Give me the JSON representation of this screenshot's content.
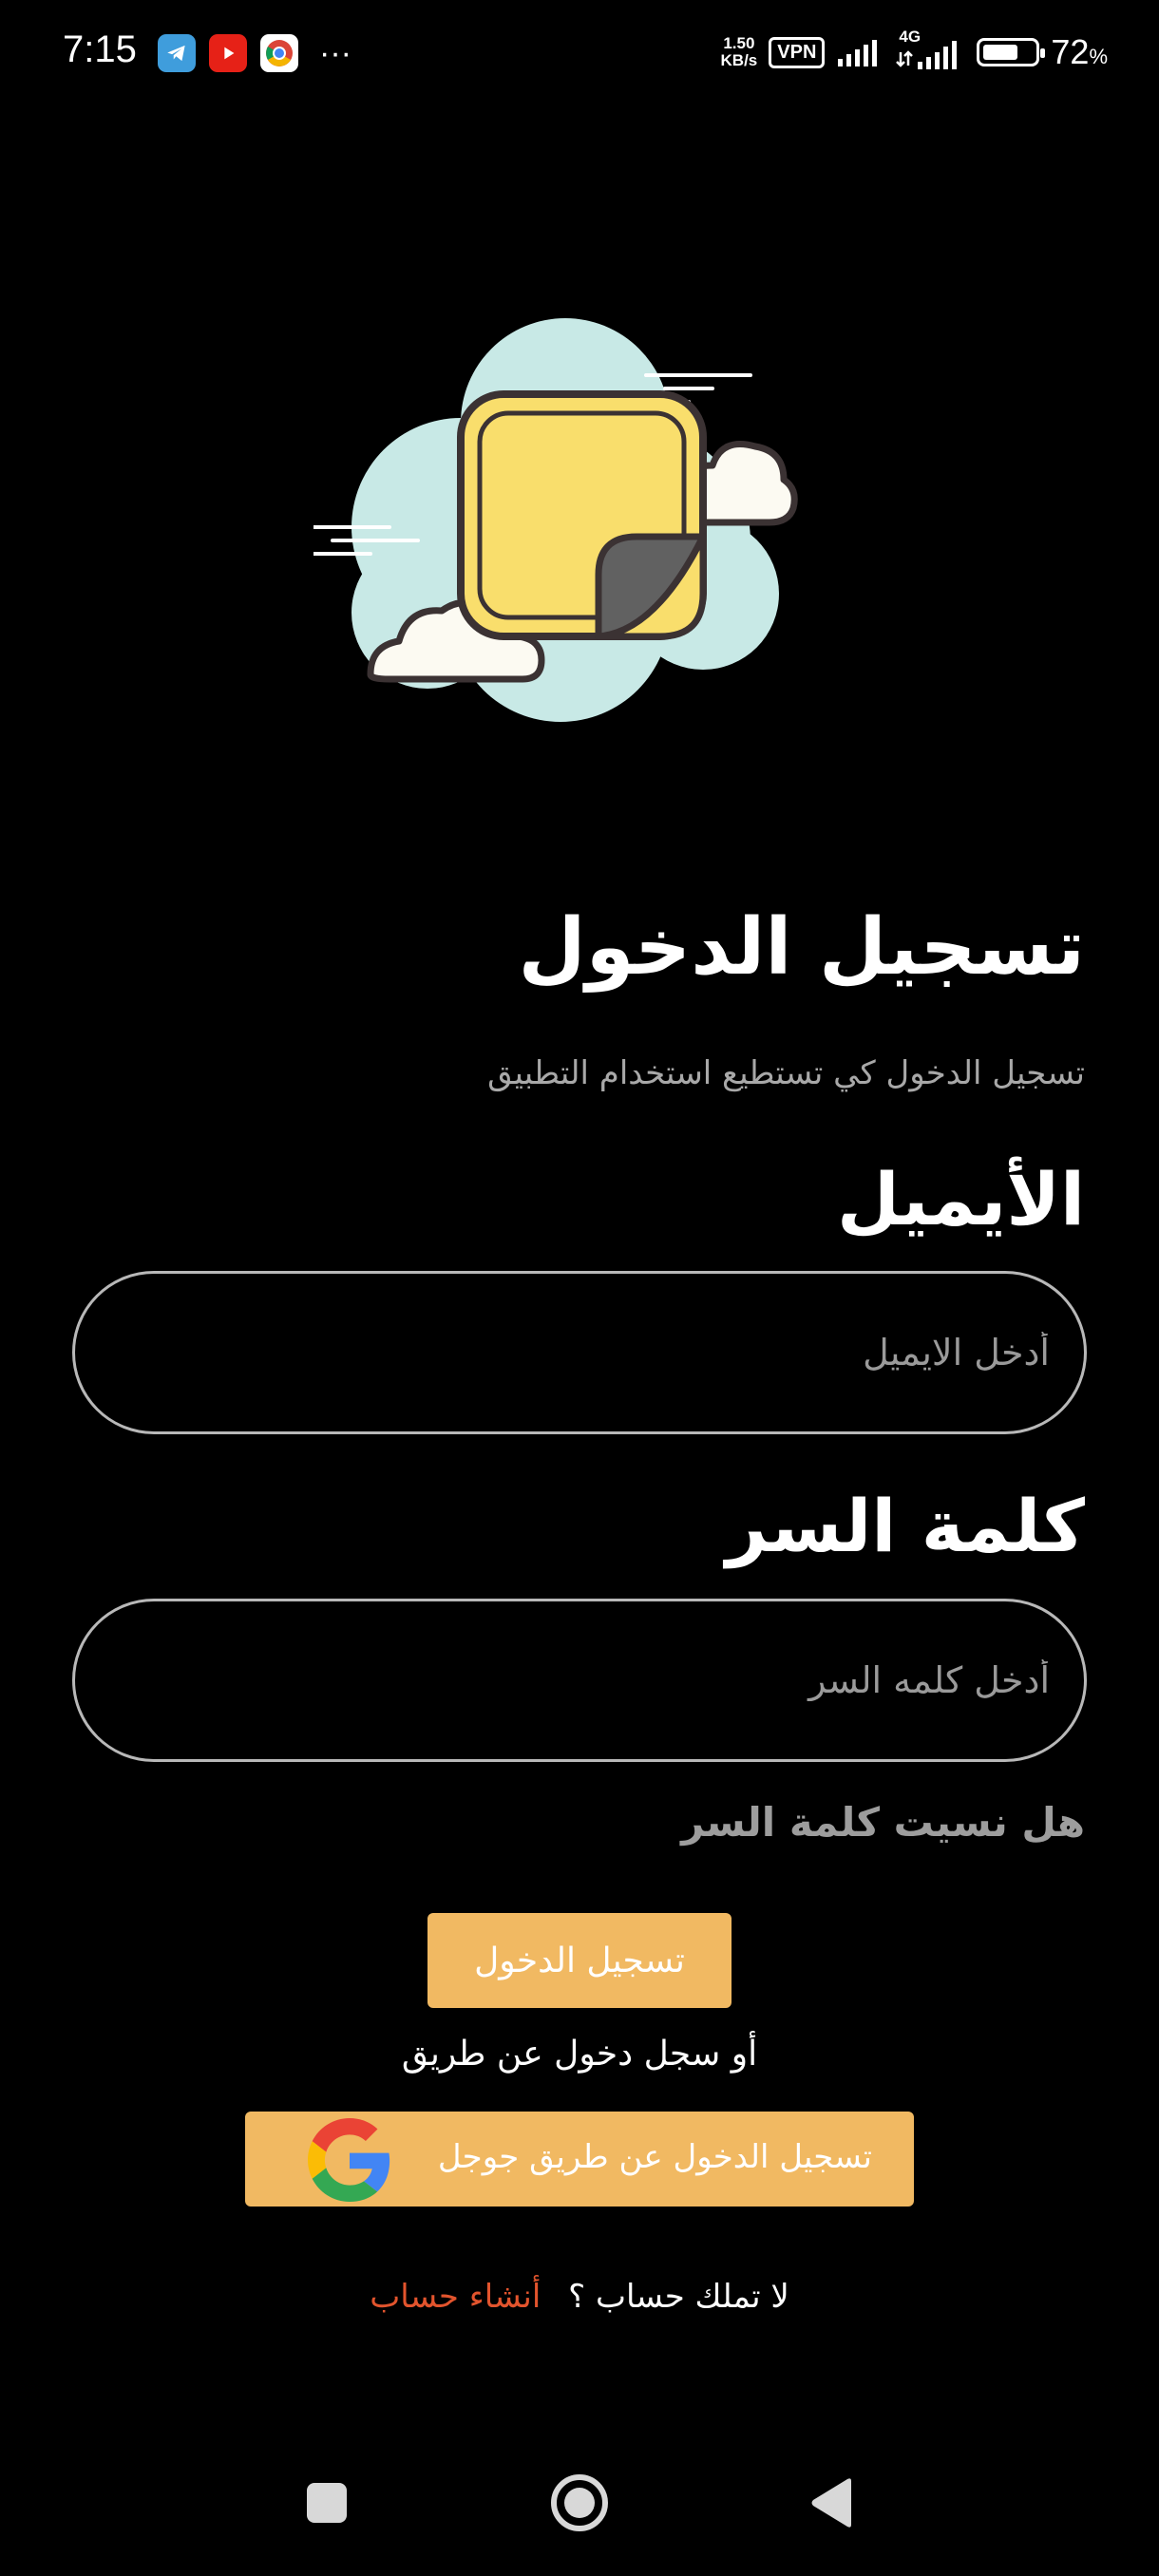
{
  "status_bar": {
    "time": "7:15",
    "more": "···",
    "speed_value": "1.50",
    "speed_unit": "KB/s",
    "vpn": "VPN",
    "network": "4G",
    "battery_level": 72,
    "battery_text": "72",
    "battery_unit": "%"
  },
  "login": {
    "title": "تسجيل الدخول",
    "subtitle": "تسجيل الدخول كي تستطيع استخدام التطبيق"
  },
  "email": {
    "label": "الأيميل",
    "placeholder": "أدخل الايميل",
    "value": ""
  },
  "password": {
    "label": "كلمة السر",
    "placeholder": "أدخل كلمه السر",
    "value": ""
  },
  "forgot_password": "هل نسيت كلمة السر",
  "login_button": "تسجيل الدخول",
  "or_text": "أو سجل دخول عن طريق",
  "google_button": "تسجيل الدخول عن طريق جوجل",
  "signup": {
    "question": "لا تملك حساب ؟",
    "link": "أنشاء حساب"
  },
  "colors": {
    "accent": "#f1b962",
    "link": "#e2542d",
    "background": "#000000"
  },
  "icons": {
    "hero": "sticky-note-cloud-illustration",
    "google": "google-g-logo",
    "nav_recents": "square-icon",
    "nav_home": "circle-home-icon",
    "nav_back": "triangle-back-icon"
  }
}
